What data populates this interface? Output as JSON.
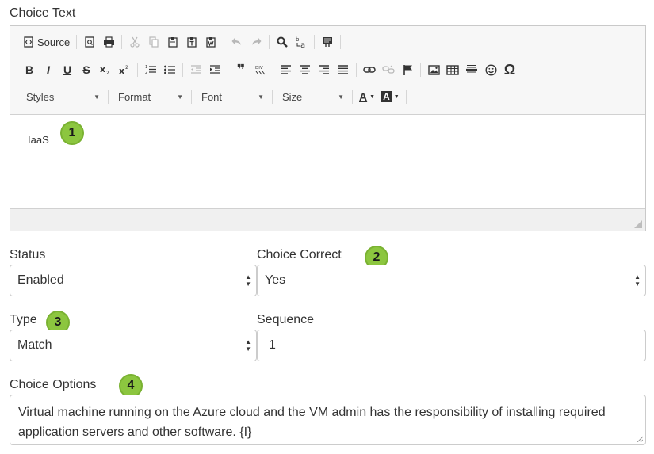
{
  "choice_text": {
    "label": "Choice Text",
    "content": "IaaS",
    "toolbar": {
      "source_label": "Source",
      "styles_label": "Styles",
      "format_label": "Format",
      "font_label": "Font",
      "size_label": "Size",
      "bold_label": "B",
      "italic_label": "I",
      "underline_label": "U",
      "strike_label": "S",
      "quote_label": "❞",
      "omega_label": "Ω",
      "text_color_label": "A",
      "bg_color_label": "A"
    }
  },
  "status": {
    "label": "Status",
    "value": "Enabled"
  },
  "choice_correct": {
    "label": "Choice Correct",
    "value": "Yes"
  },
  "type": {
    "label": "Type",
    "value": "Match"
  },
  "sequence": {
    "label": "Sequence",
    "value": "1"
  },
  "choice_options": {
    "label": "Choice Options",
    "value": "Virtual machine running on the Azure cloud and the VM admin has the responsibility of installing required application servers and other software.  {I}"
  },
  "badges": {
    "b1": "1",
    "b2": "2",
    "b3": "3",
    "b4": "4"
  },
  "colors": {
    "badge": "#8cc63f",
    "toolbar_bg": "#f7f7f7",
    "border": "#cccccc"
  }
}
